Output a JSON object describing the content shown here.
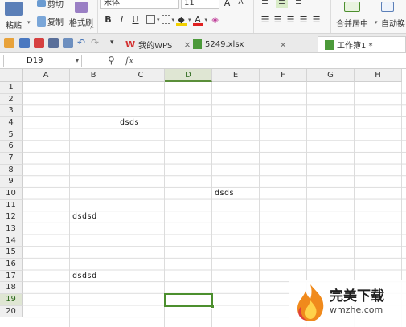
{
  "ribbon": {
    "cut_label": "剪切",
    "paste_label": "粘贴",
    "copy_label": "复制",
    "format_painter_label": "格式刷",
    "font_name": "宋体",
    "font_size": "11",
    "bold": "B",
    "italic": "I",
    "underline": "U",
    "font_color_letter": "A",
    "merge_center_label": "合并居中",
    "auto_wrap_label": "自动换",
    "accent_color": "#4c8f2e"
  },
  "tabs": {
    "wps_label": "我的WPS",
    "file1_label": "5249.xlsx",
    "active_label": "工作簿1 *",
    "close_glyph": "×"
  },
  "formula_bar": {
    "cell_ref": "D19",
    "fx_label": "fx"
  },
  "sheet": {
    "columns": [
      "A",
      "B",
      "C",
      "D",
      "E",
      "F",
      "G",
      "H"
    ],
    "selected_column": "D",
    "rows": [
      "1",
      "2",
      "3",
      "4",
      "5",
      "6",
      "7",
      "8",
      "9",
      "10",
      "11",
      "12",
      "13",
      "14",
      "15",
      "16",
      "17",
      "18",
      "19",
      "20"
    ],
    "selected_row": "19",
    "cells": [
      {
        "ref": "C4",
        "value": "dsds"
      },
      {
        "ref": "E10",
        "value": "dsds"
      },
      {
        "ref": "B12",
        "value": "dsdsd"
      },
      {
        "ref": "B17",
        "value": "dsdsd"
      }
    ]
  },
  "watermark": {
    "title": "完美下载",
    "subtitle": "wmzhe.com"
  }
}
